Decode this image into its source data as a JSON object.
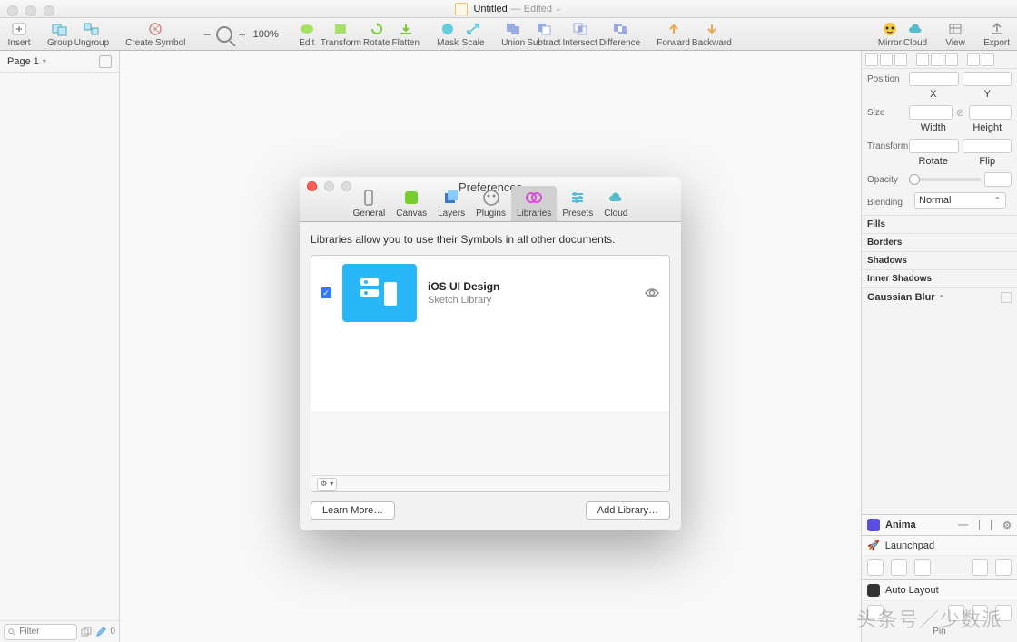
{
  "title": {
    "doc": "Untitled",
    "suffix": "— Edited"
  },
  "toolbar": {
    "insert": "Insert",
    "group": "Group",
    "ungroup": "Ungroup",
    "create_symbol": "Create Symbol",
    "zoom": "100%",
    "edit": "Edit",
    "transform": "Transform",
    "rotate": "Rotate",
    "flatten": "Flatten",
    "mask": "Mask",
    "scale": "Scale",
    "union": "Union",
    "subtract": "Subtract",
    "intersect": "Intersect",
    "difference": "Difference",
    "forward": "Forward",
    "backward": "Backward",
    "mirror": "Mirror",
    "cloud": "Cloud",
    "view": "View",
    "export": "Export"
  },
  "left": {
    "page": "Page 1",
    "filter_ph": "Filter",
    "count": "0"
  },
  "insp": {
    "position": "Position",
    "x": "X",
    "y": "Y",
    "size": "Size",
    "width": "Width",
    "height": "Height",
    "transform": "Transform",
    "rotate": "Rotate",
    "flip": "Flip",
    "opacity": "Opacity",
    "blending": "Blending",
    "blend_val": "Normal",
    "fills": "Fills",
    "borders": "Borders",
    "shadows": "Shadows",
    "inner": "Inner Shadows",
    "blur": "Gaussian Blur"
  },
  "plugins": {
    "anima": "Anima",
    "launchpad": "Launchpad",
    "auto": "Auto Layout",
    "pin": "Pin"
  },
  "prefs": {
    "title": "Preferences",
    "tabs": {
      "general": "General",
      "canvas": "Canvas",
      "layers": "Layers",
      "plugins": "Plugins",
      "libraries": "Libraries",
      "presets": "Presets",
      "cloud": "Cloud"
    },
    "intro": "Libraries allow you to use their Symbols in all other documents.",
    "lib": {
      "name": "iOS UI Design",
      "sub": "Sketch Library"
    },
    "learn": "Learn More…",
    "add": "Add Library…"
  },
  "watermark": "头条号／少数派"
}
